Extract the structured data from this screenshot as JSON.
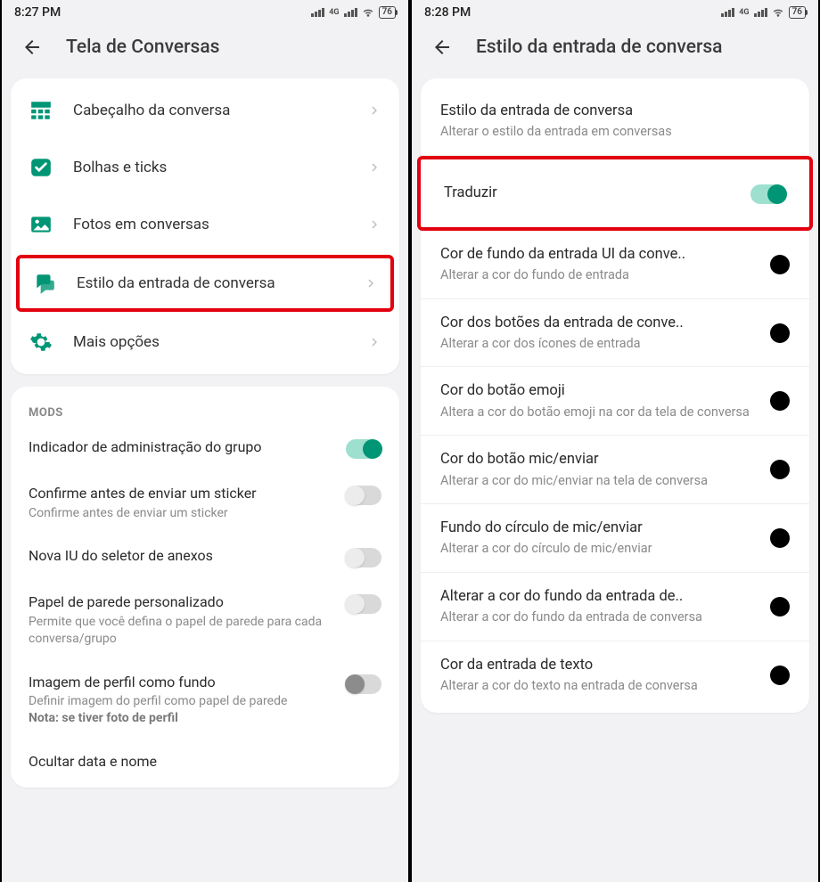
{
  "left": {
    "status": {
      "time": "8:27 PM",
      "net_label": "4G",
      "battery": "76"
    },
    "header_title": "Tela de Conversas",
    "nav": [
      {
        "label": "Cabeçalho da conversa"
      },
      {
        "label": "Bolhas e ticks"
      },
      {
        "label": "Fotos em conversas"
      },
      {
        "label": "Estilo da entrada de conversa"
      },
      {
        "label": "Mais opções"
      }
    ],
    "section": "MODS",
    "mods": [
      {
        "title": "Indicador de administração do grupo",
        "sub": "",
        "note": "",
        "on": true
      },
      {
        "title": "Confirme antes de enviar um sticker",
        "sub": "Confirme antes de enviar um sticker",
        "note": "",
        "on": false
      },
      {
        "title": "Nova IU do seletor de anexos",
        "sub": "",
        "note": "",
        "on": false
      },
      {
        "title": "Papel de parede personalizado",
        "sub": "Permite que você defina o papel de parede para cada conversa/grupo",
        "note": "",
        "on": false
      },
      {
        "title": "Imagem de perfil como fundo",
        "sub": "Definir imagem do perfil como papel de parede",
        "note": "Nota: se tiver foto de perfil",
        "on": false,
        "gray": true
      },
      {
        "title": "Ocultar data e nome",
        "sub": "",
        "note": "",
        "on": false
      }
    ]
  },
  "right": {
    "status": {
      "time": "8:28 PM",
      "net_label": "4G",
      "battery": "76"
    },
    "header_title": "Estilo da entrada de conversa",
    "intro": {
      "title": "Estilo da entrada de conversa",
      "sub": "Alterar o estilo da entrada em conversas"
    },
    "toggle": {
      "title": "Traduzir",
      "on": true
    },
    "colors": [
      {
        "title": "Cor de fundo da entrada UI da conve..",
        "sub": "Alterar a cor do fundo de entrada"
      },
      {
        "title": "Cor dos botões da entrada de conve..",
        "sub": "Alterar a cor dos ícones de entrada"
      },
      {
        "title": "Cor do botão emoji",
        "sub": "Altera a cor do botão emoji na cor da tela de conversa"
      },
      {
        "title": "Cor do botão mic/enviar",
        "sub": "Alterar a cor do mic/enviar na tela de conversa"
      },
      {
        "title": "Fundo do círculo de mic/enviar",
        "sub": "Alterar a cor do círculo de mic/enviar"
      },
      {
        "title": "Alterar a cor do fundo da entrada de..",
        "sub": "Alterar a cor do fundo da entrada de conversa"
      },
      {
        "title": "Cor da entrada de texto",
        "sub": "Alterar a cor do texto na entrada de conversa"
      }
    ]
  }
}
